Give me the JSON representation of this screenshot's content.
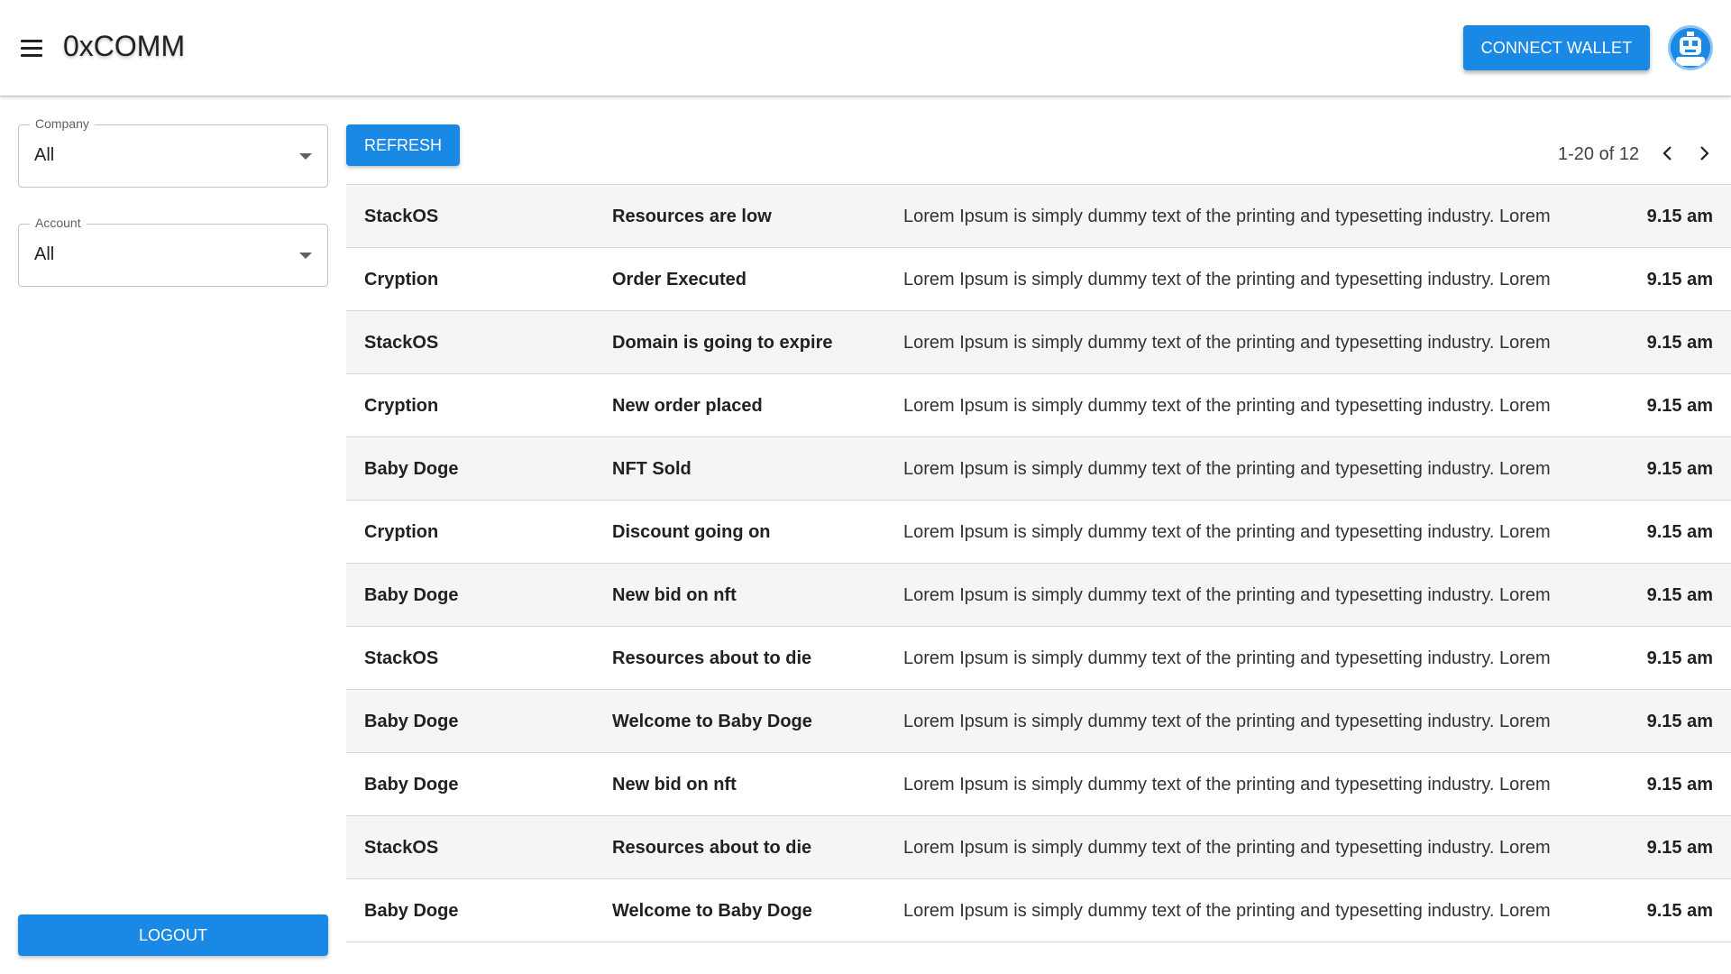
{
  "app": {
    "title": "0xCOMM",
    "connect_label": "CONNECT WALLET",
    "accent_color": "#1a88e5"
  },
  "filters": {
    "company": {
      "label": "Company",
      "value": "All"
    },
    "account": {
      "label": "Account",
      "value": "All"
    }
  },
  "sidebar": {
    "logout_label": "LOGOUT"
  },
  "toolbar": {
    "refresh_label": "REFRESH",
    "pagination_text": "1-20 of 12"
  },
  "icons": {
    "menu": "menu-icon",
    "avatar": "avatar-icon",
    "dropdown": "chevron-down-icon",
    "prev": "chevron-left-icon",
    "next": "chevron-right-icon"
  },
  "notifications": [
    {
      "company": "StackOS",
      "subject": "Resources are low",
      "message": "Lorem Ipsum is simply dummy text of the printing and typesetting industry. Lorem",
      "time": "9.15 am"
    },
    {
      "company": "Cryption",
      "subject": "Order Executed",
      "message": "Lorem Ipsum is simply dummy text of the printing and typesetting industry. Lorem",
      "time": "9.15 am"
    },
    {
      "company": "StackOS",
      "subject": "Domain is going to expire",
      "message": "Lorem Ipsum is simply dummy text of the printing and typesetting industry. Lorem",
      "time": "9.15 am"
    },
    {
      "company": "Cryption",
      "subject": "New order placed",
      "message": "Lorem Ipsum is simply dummy text of the printing and typesetting industry. Lorem",
      "time": "9.15 am"
    },
    {
      "company": "Baby Doge",
      "subject": "NFT Sold",
      "message": "Lorem Ipsum is simply dummy text of the printing and typesetting industry. Lorem",
      "time": "9.15 am"
    },
    {
      "company": "Cryption",
      "subject": "Discount going on",
      "message": "Lorem Ipsum is simply dummy text of the printing and typesetting industry. Lorem",
      "time": "9.15 am"
    },
    {
      "company": "Baby Doge",
      "subject": "New bid on nft",
      "message": "Lorem Ipsum is simply dummy text of the printing and typesetting industry. Lorem",
      "time": "9.15 am"
    },
    {
      "company": "StackOS",
      "subject": "Resources about to die",
      "message": "Lorem Ipsum is simply dummy text of the printing and typesetting industry. Lorem",
      "time": "9.15 am"
    },
    {
      "company": "Baby Doge",
      "subject": "Welcome to Baby Doge",
      "message": "Lorem Ipsum is simply dummy text of the printing and typesetting industry. Lorem",
      "time": "9.15 am"
    },
    {
      "company": "Baby Doge",
      "subject": "New bid on nft",
      "message": "Lorem Ipsum is simply dummy text of the printing and typesetting industry. Lorem",
      "time": "9.15 am"
    },
    {
      "company": "StackOS",
      "subject": "Resources about to die",
      "message": "Lorem Ipsum is simply dummy text of the printing and typesetting industry. Lorem",
      "time": "9.15 am"
    },
    {
      "company": "Baby Doge",
      "subject": "Welcome to Baby Doge",
      "message": "Lorem Ipsum is simply dummy text of the printing and typesetting industry. Lorem",
      "time": "9.15 am"
    }
  ]
}
